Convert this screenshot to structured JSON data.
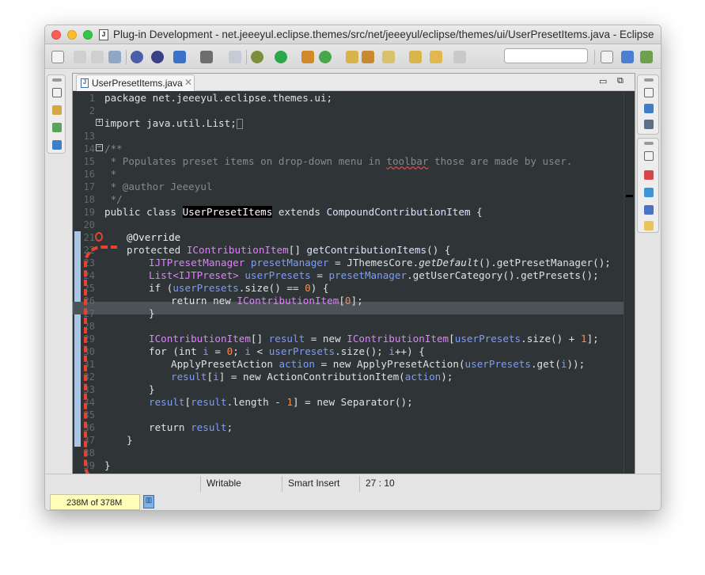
{
  "window": {
    "title": "Plug-in Development - net.jeeeyul.eclipse.themes/src/net/jeeeyul/eclipse/themes/ui/UserPresetItems.java - Eclipse"
  },
  "editor": {
    "tab_label": "UserPresetItems.java",
    "tab_close": "✕",
    "minimize": "▭",
    "maximize": "⧉"
  },
  "code": {
    "line_numbers": [
      "1",
      "2",
      "",
      "13",
      "14",
      "15",
      "16",
      "17",
      "18",
      "19",
      "20",
      "21",
      "22",
      "23",
      "24",
      "25",
      "26",
      "27",
      "28",
      "29",
      "30",
      "31",
      "32",
      "33",
      "34",
      "35",
      "36",
      "37",
      "38",
      "39"
    ],
    "lines": {
      "l1": "package net.jeeeyul.eclipse.themes.ui;",
      "l3a": "import java.util.List;",
      "l14": "/**",
      "l15a": " * Populates preset items on drop-down menu in ",
      "l15b": "toolbar",
      "l15c": " those are made by user.",
      "l16": " *",
      "l17": " * @author Jeeeyul",
      "l18": " */",
      "l19a": "public class ",
      "l19b": "UserPresetItems",
      "l19c": " extends ",
      "l19d": "CompoundContributionItem",
      "l19e": " {",
      "l21": "@Override",
      "l22a": "protected ",
      "l22b": "IContributionItem",
      "l22c": "[] ",
      "l22d": "getContributionItems",
      "l22e": "() {",
      "l23a": "IJTPresetManager ",
      "l23b": "presetManager",
      "l23c": " = JThemesCore.",
      "l23d": "getDefault",
      "l23e": "().getPresetManager();",
      "l24a": "List<IJTPreset> ",
      "l24b": "userPresets",
      "l24c": " = ",
      "l24d": "presetManager",
      "l24e": ".getUserCategory().getPresets();",
      "l25a": "if (",
      "l25b": "userPresets",
      "l25c": ".size() == ",
      "l25d": "0",
      "l25e": ") {",
      "l26a": "return new ",
      "l26b": "IContributionItem",
      "l26c": "[",
      "l26d": "0",
      "l26e": "];",
      "l27": "}",
      "l29a": "IContributionItem",
      "l29b": "[] ",
      "l29c": "result",
      "l29d": " = new ",
      "l29e": "IContributionItem",
      "l29f": "[",
      "l29g": "userPresets",
      "l29h": ".size() + ",
      "l29i": "1",
      "l29j": "];",
      "l30a": "for (int ",
      "l30b": "i",
      "l30c": " = ",
      "l30d": "0",
      "l30e": "; ",
      "l30f": "i",
      "l30g": " < ",
      "l30h": "userPresets",
      "l30i": ".size(); ",
      "l30j": "i",
      "l30k": "++) {",
      "l31a": "ApplyPresetAction ",
      "l31b": "action",
      "l31c": " = new ApplyPresetAction(",
      "l31d": "userPresets",
      "l31e": ".get(",
      "l31f": "i",
      "l31g": "));",
      "l32a": "result",
      "l32b": "[",
      "l32c": "i",
      "l32d": "] = new ActionContributionItem(",
      "l32e": "action",
      "l32f": ");",
      "l33": "}",
      "l34a": "result",
      "l34b": "[",
      "l34c": "result",
      "l34d": ".length - ",
      "l34e": "1",
      "l34f": "] = new Separator();",
      "l36a": "return ",
      "l36b": "result",
      "l36c": ";",
      "l37": "}",
      "l39": "}"
    }
  },
  "status": {
    "writable": "Writable",
    "insert_mode": "Smart Insert",
    "cursor": "27 : 10",
    "heap": "238M of 378M"
  },
  "colors": {
    "editor_bg": "#2f3437",
    "current_line": "#4b5357",
    "annotation_dash": "#e8432f",
    "heap_bg": "#fffdb9"
  },
  "icons": [
    "close-light",
    "minimize-light",
    "zoom-light",
    "java-file-icon",
    "new-icon",
    "save-icon",
    "print-icon",
    "debug-icon",
    "run-icon",
    "search-icon",
    "back-icon",
    "forward-icon",
    "perspective-icon",
    "trash-icon"
  ]
}
